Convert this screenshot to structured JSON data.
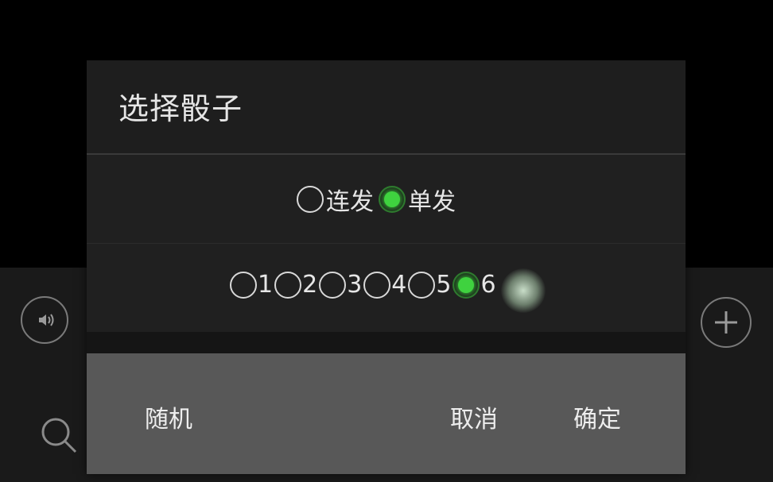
{
  "dialog": {
    "title": "选择骰子",
    "mode_options": [
      {
        "label": "连发",
        "checked": false
      },
      {
        "label": "单发",
        "checked": true
      }
    ],
    "number_options": [
      {
        "label": "1",
        "checked": false
      },
      {
        "label": "2",
        "checked": false
      },
      {
        "label": "3",
        "checked": false
      },
      {
        "label": "4",
        "checked": false
      },
      {
        "label": "5",
        "checked": false
      },
      {
        "label": "6",
        "checked": true
      }
    ],
    "buttons": {
      "random": "随机",
      "cancel": "取消",
      "ok": "确定"
    }
  },
  "background": {
    "icons": [
      "voice-icon",
      "plus-icon",
      "search-icon"
    ]
  },
  "colors": {
    "dialog_bg": "#1e1e1e",
    "button_bar_bg": "#585858",
    "radio_checked": "#3fd23f",
    "text": "#e6e6e6"
  }
}
